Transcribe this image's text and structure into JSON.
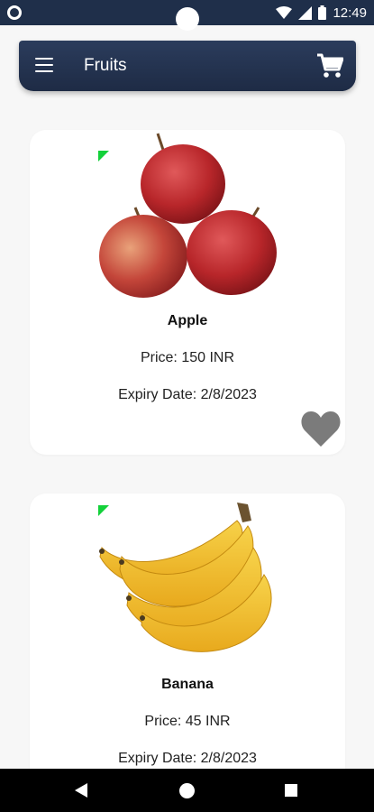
{
  "status_bar": {
    "time": "12:49",
    "icons": [
      "circle-icon",
      "wifi-icon",
      "signal-icon",
      "battery-icon"
    ]
  },
  "app_bar": {
    "title": "Fruits",
    "menu_icon": "menu-icon",
    "cart_icon": "cart-icon"
  },
  "products": [
    {
      "name": "Apple",
      "price": "Price: 150 INR",
      "expiry": "Expiry Date: 2/8/2023",
      "image": "apple-image",
      "favorite_icon": "heart-icon"
    },
    {
      "name": "Banana",
      "price": "Price: 45 INR",
      "expiry": "Expiry Date: 2/8/2023",
      "image": "banana-image"
    }
  ],
  "nav_bar": {
    "icons": [
      "back-icon",
      "home-icon",
      "recent-apps-icon"
    ]
  },
  "colors": {
    "app_bar": "#1e2b45",
    "status_bar": "#1f2f4a",
    "accent_flag": "#13d13a",
    "heart": "#7b7b7b",
    "background": "#f7f7f7"
  }
}
